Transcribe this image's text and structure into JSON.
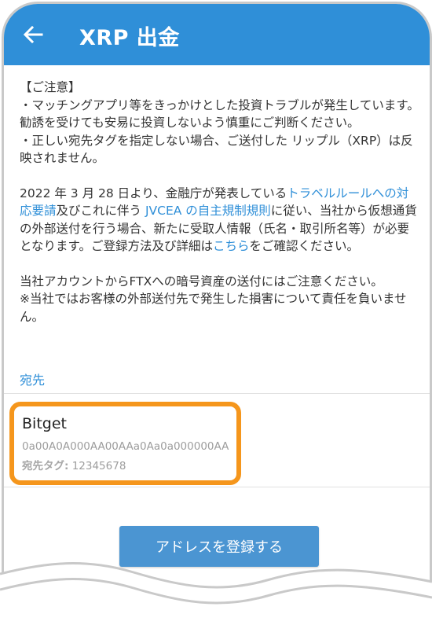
{
  "appbar": {
    "title": "XRP 出金",
    "back_icon": "arrow-left-icon",
    "color": "#2f8fd8"
  },
  "notice": {
    "heading": "【ご注意】",
    "bullet1": "・マッチングアプリ等をきっかけとした投資トラブルが発生しています。勧誘を受けても安易に投資しないよう慎重にご判断ください。",
    "bullet2": "・正しい宛先タグを指定しない場合、ご送付した リップル（XRP）は反映されません。",
    "travel_rule": {
      "part1": "2022 年 3 月 28 日より、金融庁が発表している",
      "link1": "トラベルルールへの対応要請",
      "part2": "及びこれに伴う ",
      "link2": "JVCEA の自主規制規則",
      "part3": "に従い、当社から仮想通貨の外部送付を行う場合、新たに受取人情報（氏名・取引所名等）が必要となります。ご登録方法及び詳細は",
      "link3": "こちら",
      "part4": "をご確認ください。"
    },
    "ftx": "当社アカウントからFTXへの暗号資産の送付にはご注意ください。",
    "disclaimer": "※当社ではお客様の外部送付先で発生した損害について責任を負いません。"
  },
  "destination": {
    "label": "宛先",
    "name": "Bitget",
    "address": "0a00A0A000AA00AAa0Aa0a000000AA",
    "tag_label": "宛先タグ:",
    "tag_value": "12345678",
    "highlight_color": "#f5961c"
  },
  "register_button": {
    "label": "アドレスを登録する"
  }
}
